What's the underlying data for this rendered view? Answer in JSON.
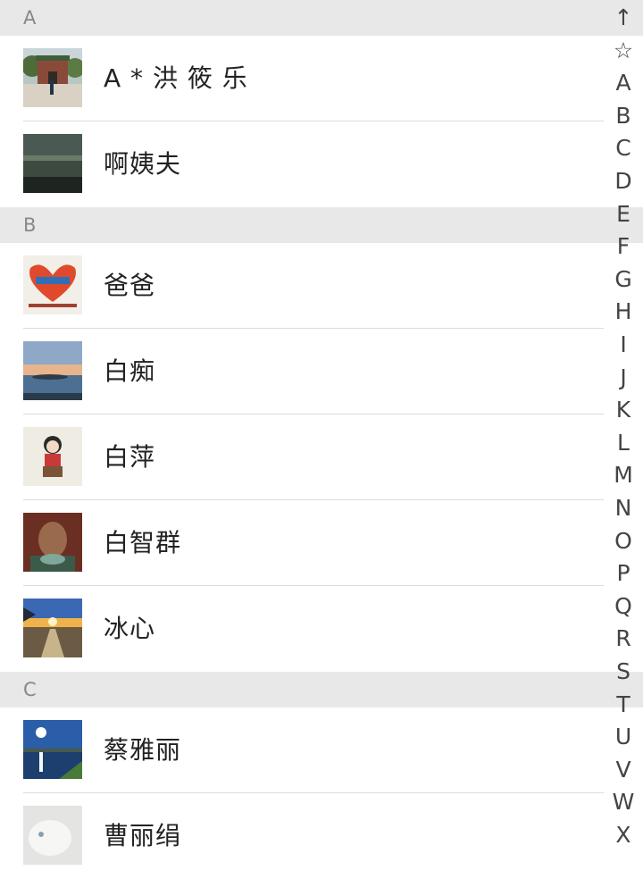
{
  "sections": [
    {
      "letter": "A",
      "contacts": [
        {
          "name": "A * 洪 筱 乐",
          "avatar": "temple-gate-photo"
        },
        {
          "name": "啊姨夫",
          "avatar": "dark-landscape-photo"
        }
      ]
    },
    {
      "letter": "B",
      "contacts": [
        {
          "name": "爸爸",
          "avatar": "heart-hands-banner"
        },
        {
          "name": "白痴",
          "avatar": "sunset-sea-photo"
        },
        {
          "name": "白萍",
          "avatar": "cartoon-figure"
        },
        {
          "name": "白智群",
          "avatar": "portrait-photo"
        },
        {
          "name": "冰心",
          "avatar": "beach-sunset-photo"
        }
      ]
    },
    {
      "letter": "C",
      "contacts": [
        {
          "name": "蔡雅丽",
          "avatar": "lake-sun-photo"
        },
        {
          "name": "曹丽绢",
          "avatar": "white-cat-photo"
        }
      ]
    }
  ],
  "index_bar": [
    "↑",
    "☆",
    "A",
    "B",
    "C",
    "D",
    "E",
    "F",
    "G",
    "H",
    "I",
    "J",
    "K",
    "L",
    "M",
    "N",
    "O",
    "P",
    "Q",
    "R",
    "S",
    "T",
    "U",
    "V",
    "W",
    "X"
  ],
  "colors": {
    "header_bg": "#e8e8e8",
    "divider": "#dcdcdc",
    "text": "#222222"
  }
}
